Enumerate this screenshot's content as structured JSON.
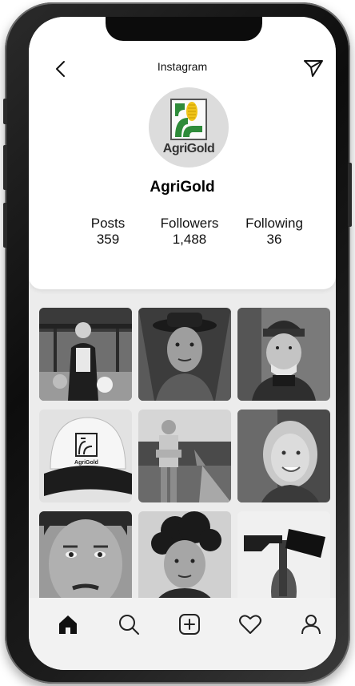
{
  "header": {
    "title": "Instagram",
    "back_icon": "chevron-left-icon",
    "send_icon": "paper-plane-icon"
  },
  "profile": {
    "name": "AgriGold",
    "logo_text": "AgriGold",
    "stats": [
      {
        "label": "Posts",
        "value": "359"
      },
      {
        "label": "Followers",
        "value": "1,488"
      },
      {
        "label": "Following",
        "value": "36"
      }
    ]
  },
  "posts": [
    {
      "subject": "elderly-woman-farm"
    },
    {
      "subject": "man-with-hat"
    },
    {
      "subject": "old-man-beanie"
    },
    {
      "subject": "agrigold-cap",
      "cap_text": "AgriGold"
    },
    {
      "subject": "man-on-road"
    },
    {
      "subject": "smiling-girl"
    },
    {
      "subject": "young-man-face"
    },
    {
      "subject": "boy-curly-hair"
    },
    {
      "subject": "garden-hoe"
    }
  ],
  "tabbar": {
    "items": [
      "home-icon",
      "search-icon",
      "add-post-icon",
      "heart-icon",
      "profile-icon"
    ]
  },
  "colors": {
    "logo_green": "#2e8b3a",
    "logo_yellow": "#f0c419",
    "screen_bg": "#ececec"
  }
}
